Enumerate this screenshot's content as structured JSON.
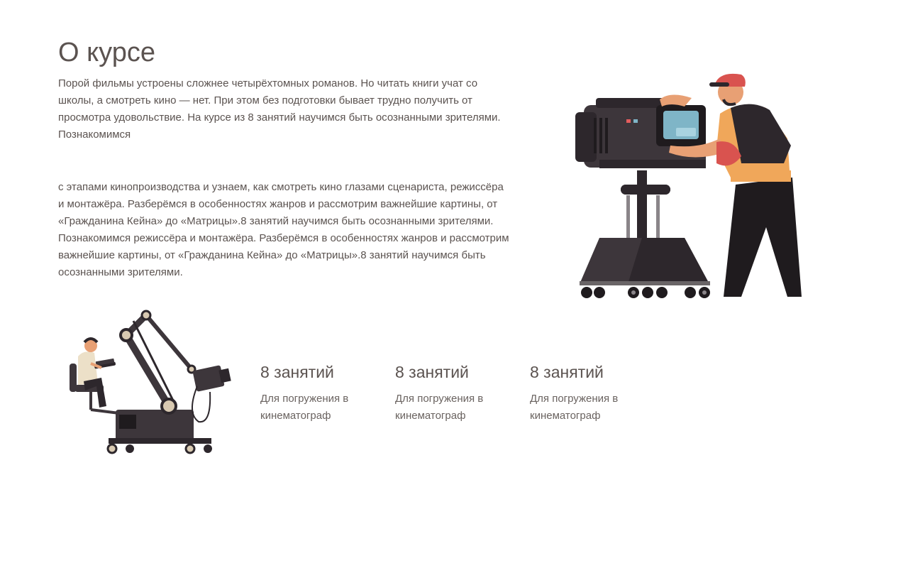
{
  "about": {
    "title": "О курсе",
    "paragraph_1": "Порой фильмы устроены сложнее четырёхтомных романов. Но читать книги учат со школы, а смотреть кино — нет. При этом без подготовки бывает трудно получить от просмотра удовольствие. На курсе из 8 занятий научимся быть осознанными зрителями. Познакомимся",
    "paragraph_2": "с этапами кинопроизводства и узнаем, как смотреть кино глазами сценариста, режиссёра и монтажёра. Разберёмся в особенностях жанров и рассмотрим важнейшие картины, от «Гражданина Кейна» до «Матрицы».8 занятий научимся быть осознанными зрителями. Познакомимся режиссёра и монтажёра. Разберёмся в особенностях жанров и рассмотрим важнейшие картины, от «Гражданина Кейна» до «Матрицы».8 занятий научимся быть осознанными зрителями."
  },
  "stats": [
    {
      "value": "8 занятий",
      "description": "Для погружения в кинематограф"
    },
    {
      "value": "8 занятий",
      "description": "Для погружения в кинематограф"
    },
    {
      "value": "8 занятий",
      "description": "Для погружения в кинематограф"
    }
  ],
  "illustrations": {
    "camera_operator": "camera-operator-illustration",
    "crane_operator": "camera-crane-illustration"
  },
  "colors": {
    "text": "#5b5350",
    "dark": "#3d363b",
    "accent_orange": "#f0a75a",
    "accent_red": "#d9534f",
    "screen_blue": "#7fb5c7"
  }
}
